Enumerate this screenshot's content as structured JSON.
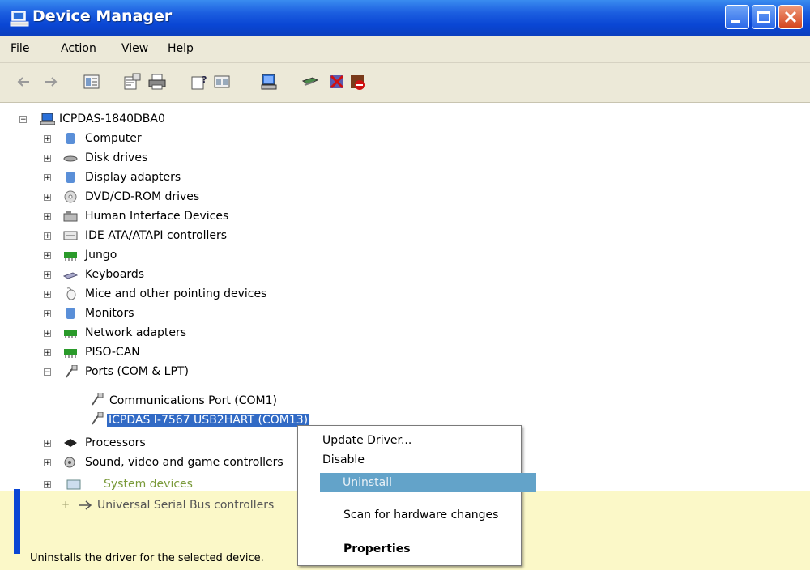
{
  "window": {
    "title": "Device Manager"
  },
  "menu": [
    "File",
    "Action",
    "View",
    "Help"
  ],
  "toolbar": {
    "icons": [
      "back-icon",
      "forward-icon",
      "show-hide-tree-icon",
      "properties-icon",
      "print-icon",
      "help-icon",
      "view-icon",
      "scan-hardware-icon",
      "update-driver-icon",
      "uninstall-icon",
      "disable-icon"
    ]
  },
  "tree": {
    "root": "ICPDAS-1840DBA0",
    "categories": [
      "Computer",
      "Disk drives",
      "Display adapters",
      "DVD/CD-ROM drives",
      "Human Interface Devices",
      "IDE ATA/ATAPI controllers",
      "Jungo",
      "Keyboards",
      "Mice and other pointing devices",
      "Monitors",
      "Network adapters",
      "PISO-CAN",
      "Ports (COM & LPT)"
    ],
    "ports_children": [
      "Communications Port (COM1)",
      "ICPDAS I-7567 USB2HART (COM13)"
    ],
    "after_ports": [
      "Processors",
      "Sound, video and game controllers",
      "System devices",
      "Universal Serial Bus controllers"
    ]
  },
  "context_menu": {
    "update_driver": "Update Driver...",
    "disable": "Disable",
    "uninstall": "Uninstall",
    "scan": "Scan for hardware changes",
    "properties": "Properties"
  },
  "status_bar": {
    "text": "Uninstalls the driver for the selected device."
  },
  "colors": {
    "title_blue": "#0a46d4",
    "selection": "#316ac5",
    "menu_highlight": "#63a3c9",
    "yellow": "#fbf8c8"
  }
}
